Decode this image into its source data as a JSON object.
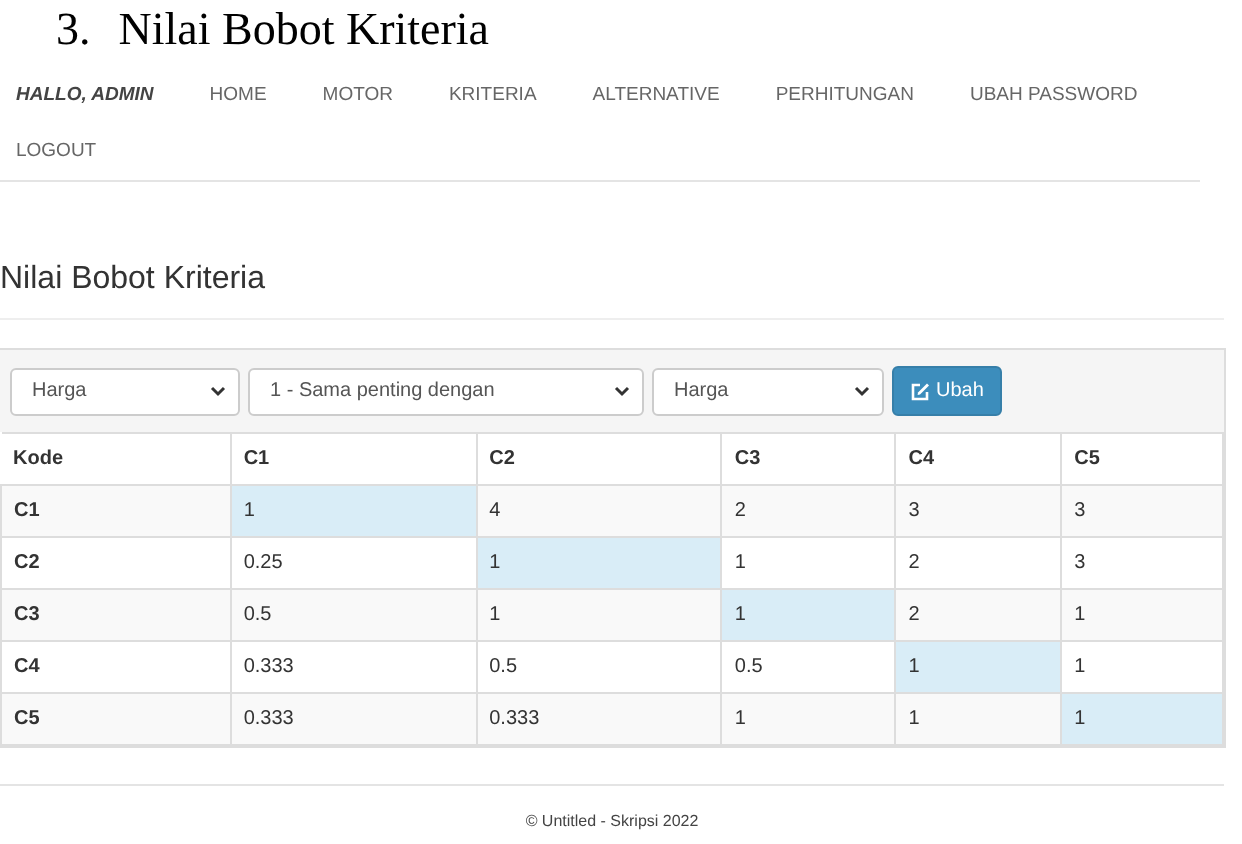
{
  "document_heading": {
    "number": "3.",
    "text": "Nilai Bobot Kriteria"
  },
  "navbar": {
    "brand": "HALLO, ADMIN",
    "links": [
      "HOME",
      "MOTOR",
      "KRITERIA",
      "ALTERNATIVE",
      "PERHITUNGAN",
      "UBAH PASSWORD",
      "LOGOUT"
    ]
  },
  "page_title": "Nilai Bobot Kriteria",
  "form": {
    "criterion_1": "Harga",
    "scale": "1 - Sama penting dengan",
    "criterion_2": "Harga",
    "button": "Ubah"
  },
  "table": {
    "code_header": "Kode",
    "columns": [
      "C1",
      "C2",
      "C3",
      "C4",
      "C5"
    ],
    "rows": [
      {
        "code": "C1",
        "cells": [
          {
            "value": "1",
            "highlighted": true
          },
          {
            "value": "4",
            "highlighted": false
          },
          {
            "value": "2",
            "highlighted": false
          },
          {
            "value": "3",
            "highlighted": false
          },
          {
            "value": "3",
            "highlighted": false
          }
        ]
      },
      {
        "code": "C2",
        "cells": [
          {
            "value": "0.25",
            "highlighted": false
          },
          {
            "value": "1",
            "highlighted": true
          },
          {
            "value": "1",
            "highlighted": false
          },
          {
            "value": "2",
            "highlighted": false
          },
          {
            "value": "3",
            "highlighted": false
          }
        ]
      },
      {
        "code": "C3",
        "cells": [
          {
            "value": "0.5",
            "highlighted": false
          },
          {
            "value": "1",
            "highlighted": false
          },
          {
            "value": "1",
            "highlighted": true
          },
          {
            "value": "2",
            "highlighted": false
          },
          {
            "value": "1",
            "highlighted": false
          }
        ]
      },
      {
        "code": "C4",
        "cells": [
          {
            "value": "0.333",
            "highlighted": false
          },
          {
            "value": "0.5",
            "highlighted": false
          },
          {
            "value": "0.5",
            "highlighted": false
          },
          {
            "value": "1",
            "highlighted": true
          },
          {
            "value": "1",
            "highlighted": false
          }
        ]
      },
      {
        "code": "C5",
        "cells": [
          {
            "value": "0.333",
            "highlighted": false
          },
          {
            "value": "0.333",
            "highlighted": false
          },
          {
            "value": "1",
            "highlighted": false
          },
          {
            "value": "1",
            "highlighted": false
          },
          {
            "value": "1",
            "highlighted": true
          }
        ]
      }
    ]
  },
  "footer": "© Untitled - Skripsi 2022"
}
